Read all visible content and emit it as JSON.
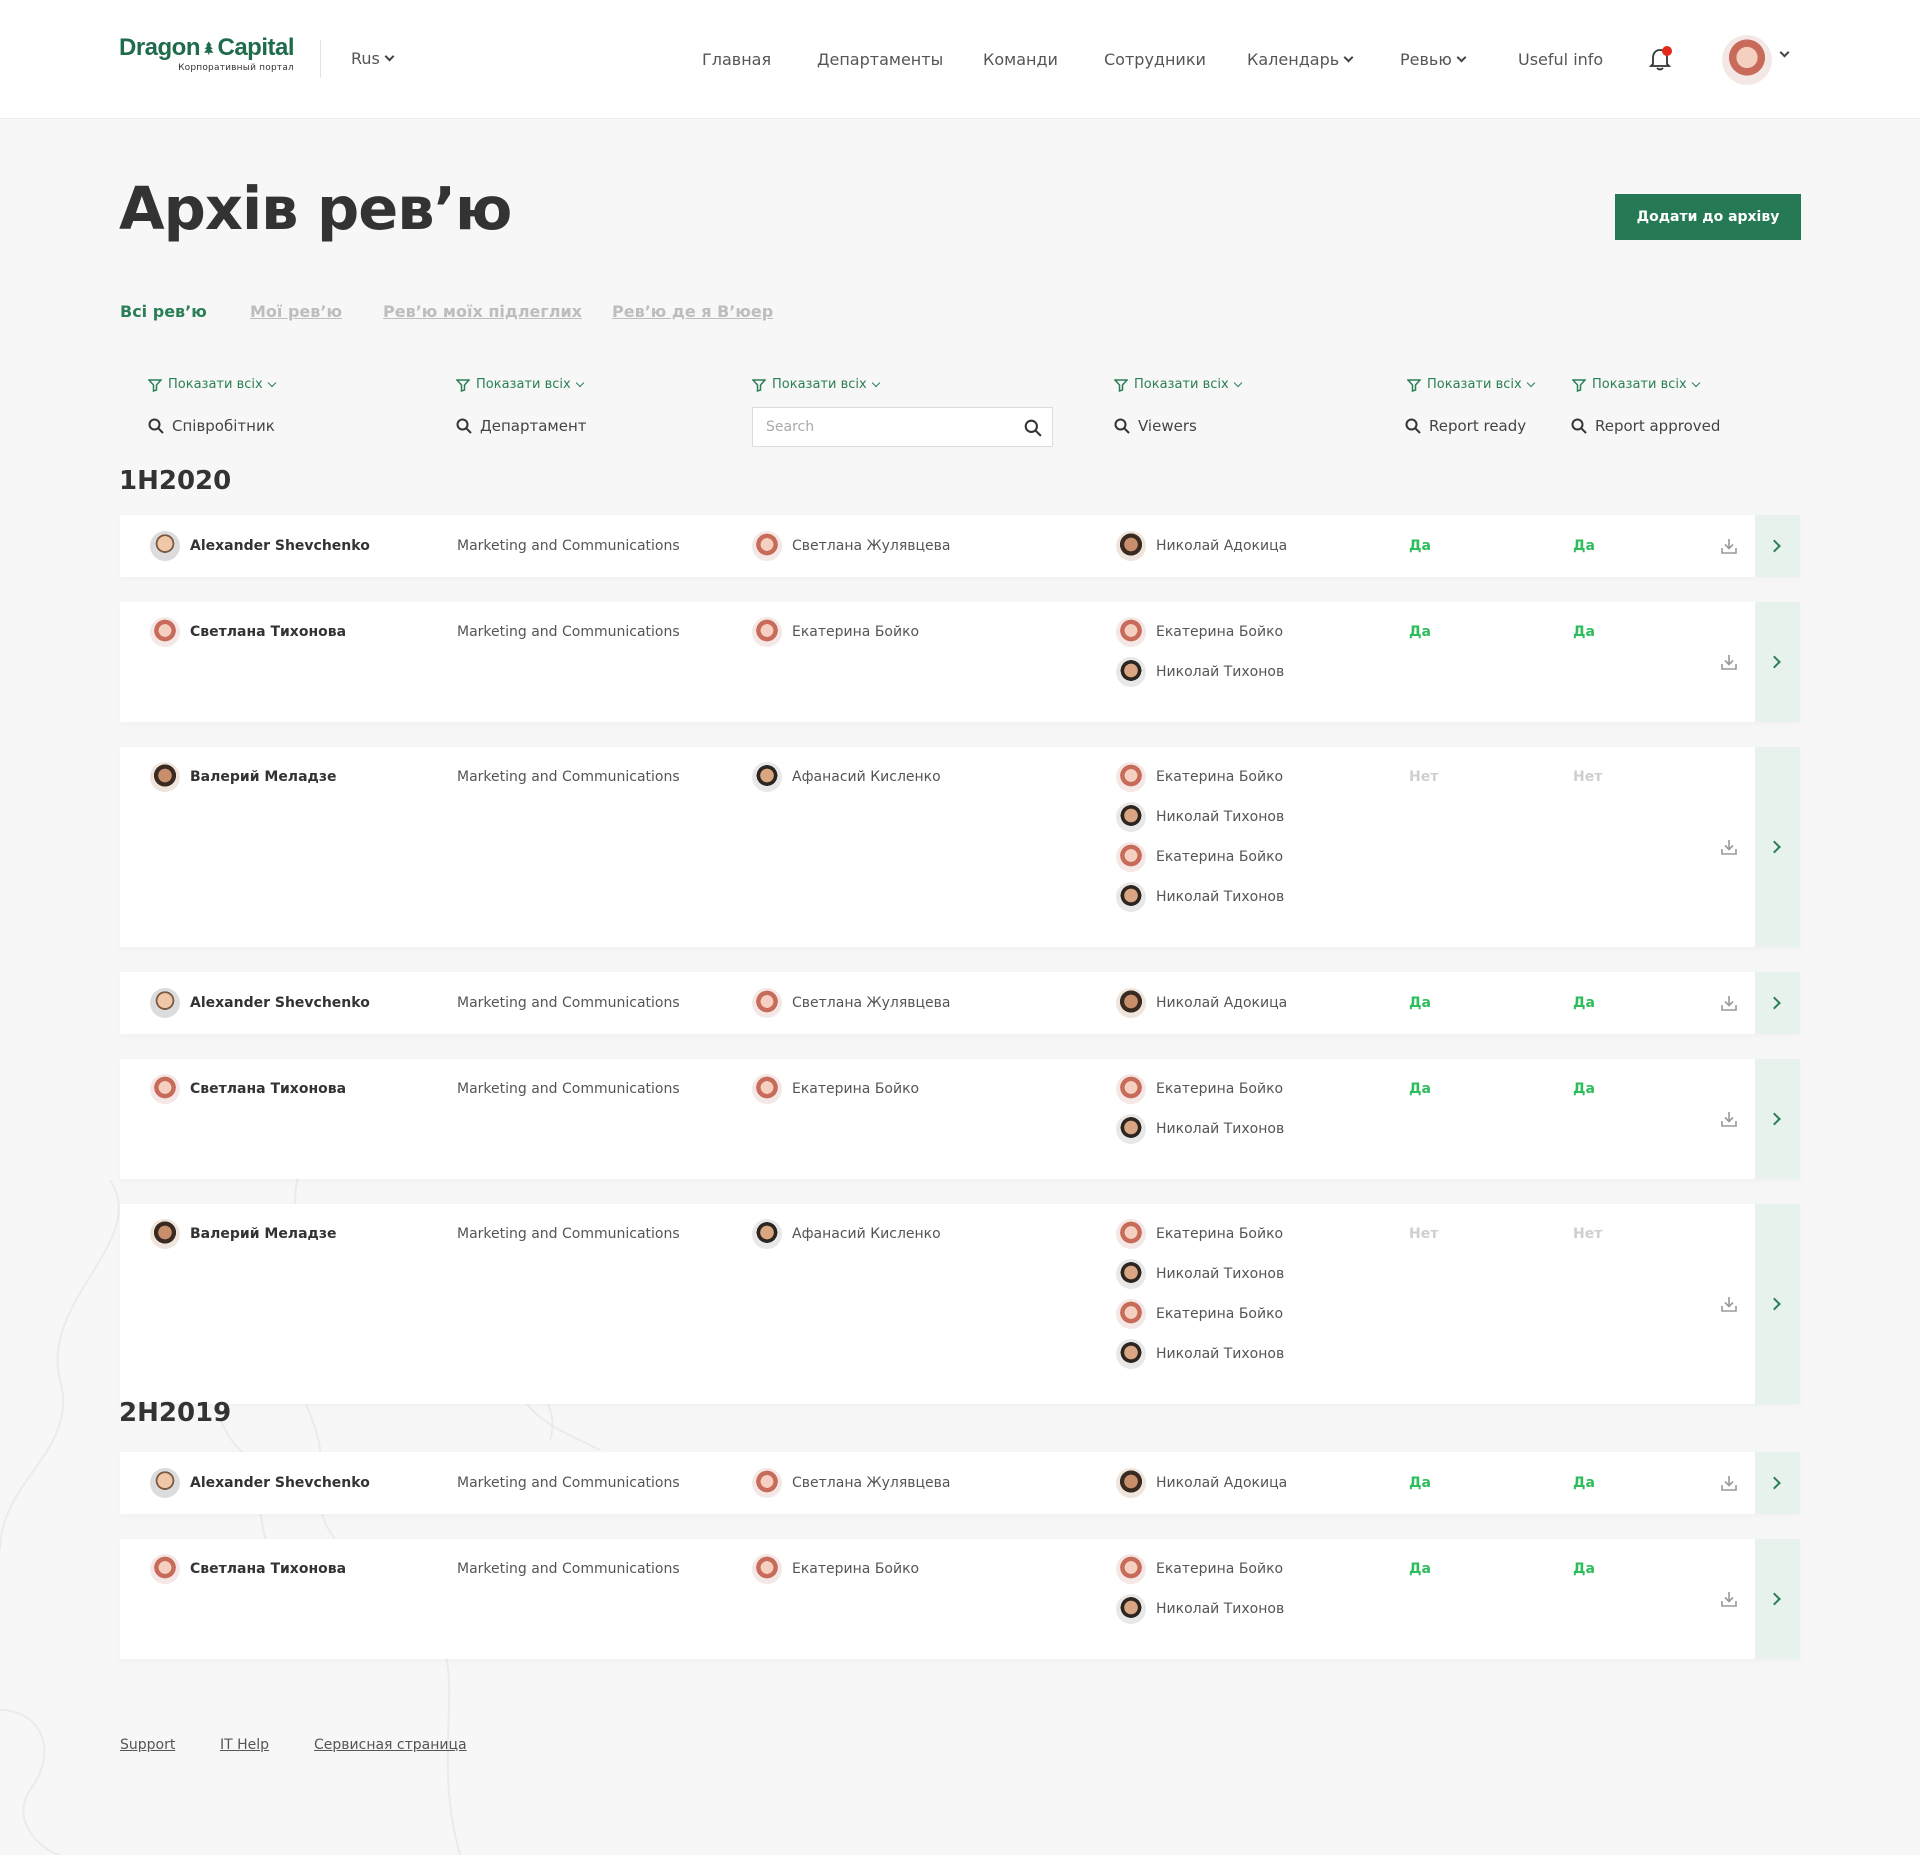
{
  "header": {
    "logo_main_left": "Dragon",
    "logo_main_right": "Capital",
    "logo_sub": "Корпоративный портал",
    "language": "Rus",
    "nav": [
      {
        "label": "Главная"
      },
      {
        "label": "Департаменты"
      },
      {
        "label": "Команди"
      },
      {
        "label": "Сотрудники"
      },
      {
        "label": "Календарь"
      },
      {
        "label": "Ревью"
      },
      {
        "label": "Useful info"
      }
    ]
  },
  "page": {
    "title": "Архів ревʼю",
    "add_button": "Додати до архіву"
  },
  "tabs": [
    {
      "label": "Всі ревʼю",
      "active": true
    },
    {
      "label": "Мої ревʼю",
      "active": false
    },
    {
      "label": "Ревʼю моїх підлеглих",
      "active": false
    },
    {
      "label": "Ревʼю де я Вʼюер",
      "active": false
    }
  ],
  "filters": {
    "show_all_label": "Показати всіх",
    "columns": [
      "Співробітник",
      "Департамент",
      "",
      "Viewers",
      "Report ready",
      "Report approved"
    ],
    "search_placeholder": "Search"
  },
  "groups": [
    {
      "title": "1H2020",
      "rows": [
        {
          "employee": "Alexander Shevchenko",
          "department": "Marketing and Communications",
          "manager": "Светлана Жулявцева",
          "viewers": [
            "Николай Адокица"
          ],
          "ready": "Да",
          "approved": "Да"
        },
        {
          "employee": "Светлана Тихонова",
          "department": "Marketing and Communications",
          "manager": "Екатерина Бойко",
          "viewers": [
            "Екатерина Бойко",
            "Николай Тихонов"
          ],
          "ready": "Да",
          "approved": "Да"
        },
        {
          "employee": "Валерий Меладзе",
          "department": "Marketing and Communications",
          "manager": "Афанасий Кисленко",
          "viewers": [
            "Екатерина Бойко",
            "Николай Тихонов",
            "Екатерина Бойко",
            "Николай Тихонов"
          ],
          "ready": "Нет",
          "approved": "Нет"
        },
        {
          "employee": "Alexander Shevchenko",
          "department": "Marketing and Communications",
          "manager": "Светлана Жулявцева",
          "viewers": [
            "Николай Адокица"
          ],
          "ready": "Да",
          "approved": "Да"
        },
        {
          "employee": "Светлана Тихонова",
          "department": "Marketing and Communications",
          "manager": "Екатерина Бойко",
          "viewers": [
            "Екатерина Бойко",
            "Николай Тихонов"
          ],
          "ready": "Да",
          "approved": "Да"
        },
        {
          "employee": "Валерий Меладзе",
          "department": "Marketing and Communications",
          "manager": "Афанасий Кисленко",
          "viewers": [
            "Екатерина Бойко",
            "Николай Тихонов",
            "Екатерина Бойко",
            "Николай Тихонов"
          ],
          "ready": "Нет",
          "approved": "Нет"
        }
      ]
    },
    {
      "title": "2H2019",
      "rows": [
        {
          "employee": "Alexander Shevchenko",
          "department": "Marketing and Communications",
          "manager": "Светлана Жулявцева",
          "viewers": [
            "Николай Адокица"
          ],
          "ready": "Да",
          "approved": "Да"
        },
        {
          "employee": "Светлана Тихонова",
          "department": "Marketing and Communications",
          "manager": "Екатерина Бойко",
          "viewers": [
            "Екатерина Бойко",
            "Николай Тихонов"
          ],
          "ready": "Да",
          "approved": "Да"
        }
      ]
    }
  ],
  "footer": {
    "links": [
      "Support",
      "IT Help",
      "Сервисная страница"
    ]
  },
  "colors": {
    "brand_green": "#257a55",
    "yes_green": "#2ebd5c",
    "no_gray": "#cfcfcf",
    "open_button_bg": "#e8f2ec"
  }
}
